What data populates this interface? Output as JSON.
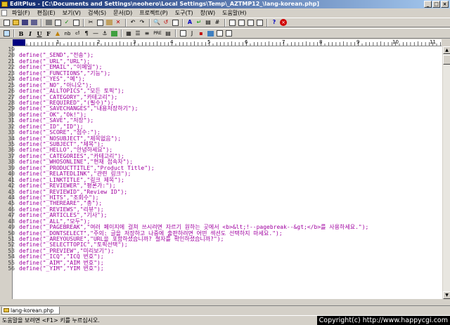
{
  "window": {
    "title": "EditPlus - [C:\\Documents and Settings\\neohero\\Local Settings\\Temp\\_AZTMP12_\\lang-korean.php]"
  },
  "menu": [
    "파일(F)",
    "편집(E)",
    "보기(V)",
    "검색(S)",
    "문서(D)",
    "프로젝트(P)",
    "도구(T)",
    "창(W)",
    "도움말(H)"
  ],
  "toolbar2": {
    "bold": "B",
    "italic": "I",
    "underline": "U",
    "font": "F",
    "nbsp": "nb",
    "paragraph": "¶",
    "pre": "PRE"
  },
  "ruler": {
    "numbers": [
      "1",
      "2",
      "3",
      "4",
      "5",
      "6",
      "7",
      "8",
      "9",
      "10",
      "11"
    ]
  },
  "editor": {
    "lines": [
      {
        "n": "19",
        "code": ""
      },
      {
        "n": "20",
        "code": "define(\"_SEND\",\"전송\");"
      },
      {
        "n": "21",
        "code": "define(\"_URL\",\"URL\");"
      },
      {
        "n": "22",
        "code": "define(\"_EMAIL\",\"이메일\");"
      },
      {
        "n": "23",
        "code": "define(\"_FUNCTIONS\",\"기능\");"
      },
      {
        "n": "24",
        "code": "define(\"_YES\",\"예\");"
      },
      {
        "n": "25",
        "code": "define(\"_NO\",\"아니오\");"
      },
      {
        "n": "26",
        "code": "define(\"_ALLTOPICS\",\"모든 토픽\");"
      },
      {
        "n": "27",
        "code": "define(\"_CATEGORY\",\"카테고리\");"
      },
      {
        "n": "28",
        "code": "define(\"_REQUIRED\",\"(필수)\");"
      },
      {
        "n": "29",
        "code": "define(\"_SAVECHANGES\",\"내용저장하기\");"
      },
      {
        "n": "30",
        "code": "define(\"_OK\",\"Ok!\");"
      },
      {
        "n": "31",
        "code": "define(\"_SAVE\",\"저장\");"
      },
      {
        "n": "32",
        "code": "define(\"_ID\",\"ID\");"
      },
      {
        "n": "33",
        "code": "define(\"_SCORE\",\"점수:\");"
      },
      {
        "n": "34",
        "code": "define(\"_NOSUBJECT\",\"제목없음\");"
      },
      {
        "n": "35",
        "code": "define(\"_SUBJECT\",\"제목\");"
      },
      {
        "n": "36",
        "code": "define(\"_HELLO\",\"안녕하세요\");"
      },
      {
        "n": "37",
        "code": "define(\"_CATEGORIES\",\"카테고리\");"
      },
      {
        "n": "38",
        "code": "define(\"_WHOSONLINE\",\"현재 접속자\");"
      },
      {
        "n": "39",
        "code": "define(\"_PRODUCTTITLE\",\"Product Title\");"
      },
      {
        "n": "40",
        "code": "define(\"_RELATEDLINK\",\"관련 링크\");"
      },
      {
        "n": "41",
        "code": "define(\"_LINKTITLE\",\"링크 제목\");"
      },
      {
        "n": "42",
        "code": "define(\"_REVIEWER\",\"평론가:\");"
      },
      {
        "n": "43",
        "code": "define(\"_REVIEWID\",\"Review ID\");"
      },
      {
        "n": "44",
        "code": "define(\"_HITS\",\"조회수\");"
      },
      {
        "n": "45",
        "code": "define(\"_THEREARE\",\"총\");"
      },
      {
        "n": "46",
        "code": "define(\"_REVIEWS\",\"리뷰\");"
      },
      {
        "n": "47",
        "code": "define(\"_ARTICLES\",\"기사\");"
      },
      {
        "n": "48",
        "code": "define(\"_ALL\",\"모두\");"
      },
      {
        "n": "49",
        "code": "define(\"_PAGEBREAK\",\"여러 페이지에 걸쳐 쓰시려면 자르기 원하는 곳에서 <b>&lt;!--pagebreak--&gt;</b>를 사용하세요.\");"
      },
      {
        "n": "50",
        "code": "define(\"_DONTSELECT\",\"주의: 글을 저장하고 나중에 출판하려면 어떤 섹션도 선택하지 마세요.\");"
      },
      {
        "n": "51",
        "code": "define(\"_AREYOUSURE\",\"URL을 포함하셨습니까? 철자를 확인하셨습니까?\");"
      },
      {
        "n": "52",
        "code": "define(\"_SELECTTOPIC\",\"토픽선택\");"
      },
      {
        "n": "53",
        "code": "define(\"_PREVIEW\",\"미리보기\");"
      },
      {
        "n": "54",
        "code": "define(\"_ICQ\",\"ICQ 번호\");"
      },
      {
        "n": "55",
        "code": "define(\"_AIM\",\"AIM 번호\");"
      },
      {
        "n": "56",
        "code": "define(\"_YIM\",\"YIM 번호\");"
      }
    ]
  },
  "tabs": [
    {
      "label": "lang-korean.php"
    }
  ],
  "status": {
    "help_text": "도움말을 보려면 <F1> 키를 누르십시오.",
    "copyright": "Copyright(c) http://www.happycgi.com"
  },
  "colors": {
    "code_text": "#a000a0",
    "title_gradient_start": "#0a246a",
    "title_gradient_end": "#a6caf0"
  }
}
